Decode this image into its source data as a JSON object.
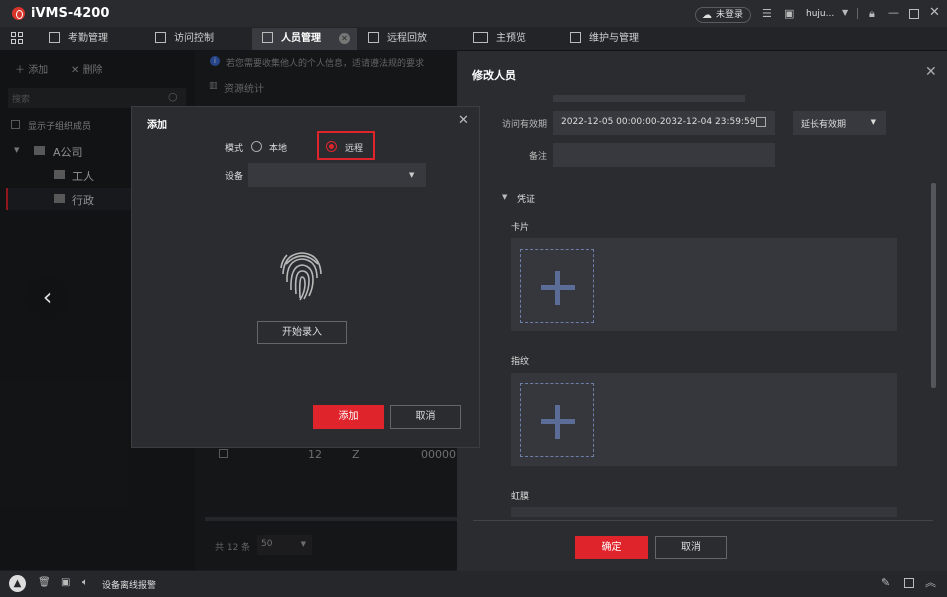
{
  "app": {
    "title": "iVMS-4200"
  },
  "titlebar": {
    "login_status": "未登录",
    "user": "huju..."
  },
  "menu": {
    "items": [
      {
        "label": "考勤管理"
      },
      {
        "label": "访问控制"
      },
      {
        "label": "人员管理"
      },
      {
        "label": "远程回放"
      },
      {
        "label": "主预览"
      },
      {
        "label": "维护与管理"
      }
    ]
  },
  "left": {
    "add": "添加",
    "delete": "删除",
    "search_placeholder": "搜索",
    "show_sub": "显示子组织成员",
    "tree": {
      "root": "A公司",
      "children": [
        "工人",
        "行政"
      ]
    }
  },
  "notice": {
    "text": "若您需要收集他人的个人信息，适请遵法规的要求",
    "resource_stats": "资源统计"
  },
  "table_row": {
    "id": "12",
    "name": "Z",
    "code": "00000"
  },
  "pagination": {
    "total": "共 12 条",
    "page_size": "50"
  },
  "add_dialog": {
    "title": "添加",
    "mode_label": "模式",
    "mode_local": "本地",
    "mode_remote": "远程",
    "device_label": "设备",
    "device_value": "",
    "start_btn": "开始录入",
    "add_btn": "添加",
    "cancel_btn": "取消"
  },
  "edit_panel": {
    "title": "修改人员",
    "validity_label": "访问有效期",
    "validity_value": "2022-12-05 00:00:00-2032-12-04 23:59:59",
    "extend_label": "延长有效期",
    "remark_label": "备注",
    "section": "凭证",
    "card_label": "卡片",
    "fingerprint_label": "指纹",
    "iris_label": "虹膜",
    "ok_btn": "确定",
    "cancel_btn": "取消"
  },
  "status": {
    "alarm": "设备离线报警"
  },
  "colors": {
    "accent": "#e0242c",
    "plus": "#5b6d96"
  }
}
